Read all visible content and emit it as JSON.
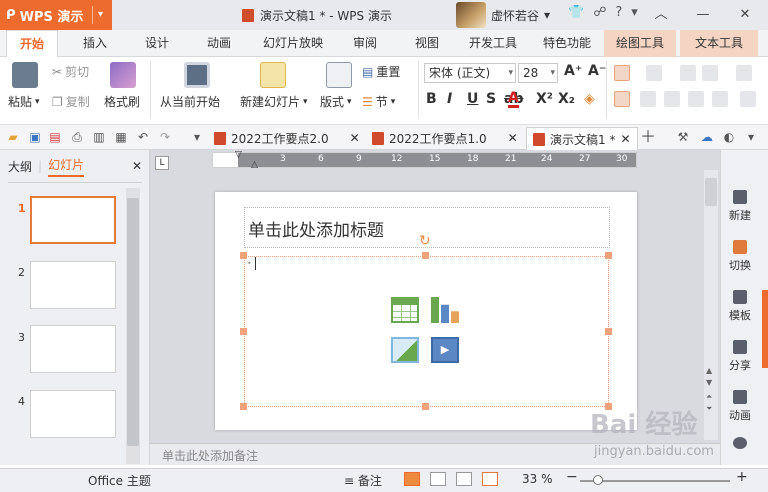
{
  "app": {
    "name": "WPS 演示",
    "doc_title": "演示文稿1 * - WPS 演示",
    "user": "虚怀若谷"
  },
  "tabs": [
    {
      "label": "开始",
      "active": true
    },
    {
      "label": "插入"
    },
    {
      "label": "设计"
    },
    {
      "label": "动画"
    },
    {
      "label": "幻灯片放映"
    },
    {
      "label": "审阅"
    },
    {
      "label": "视图"
    },
    {
      "label": "开发工具"
    },
    {
      "label": "特色功能"
    },
    {
      "label": "绘图工具",
      "context": true
    },
    {
      "label": "文本工具",
      "context": true
    }
  ],
  "ribbon": {
    "paste": "粘贴",
    "cut": "剪切",
    "copy": "复制",
    "format_painter": "格式刷",
    "play_current": "从当前开始",
    "new_slide": "新建幻灯片",
    "layout": "版式",
    "reset": "重置",
    "section": "节",
    "font": "宋体 (正文)",
    "font_size": "28"
  },
  "doc_tabs": [
    {
      "label": "2022工作要点2.0",
      "active": false
    },
    {
      "label": "2022工作要点1.0",
      "active": false
    },
    {
      "label": "演示文稿1 *",
      "active": true
    }
  ],
  "left_panel": {
    "tab_outline": "大纲",
    "tab_slides": "幻灯片",
    "slide_numbers": [
      "1",
      "2",
      "3",
      "4"
    ]
  },
  "ruler": {
    "ticks": [
      "3",
      "6",
      "9",
      "12",
      "15",
      "18",
      "21",
      "24",
      "27",
      "30"
    ]
  },
  "slide": {
    "title_placeholder": "单击此处添加标题"
  },
  "notes_placeholder": "单击此处添加备注",
  "right_panel": {
    "items": [
      "新建",
      "切换",
      "模板",
      "分享",
      "动画"
    ]
  },
  "status": {
    "theme": "Office 主题",
    "notes": "备注",
    "zoom": "33 %"
  },
  "watermark": {
    "brand": "Bai 经验",
    "url": "jingyan.baidu.com"
  },
  "colors": {
    "accent": "#ec6b2d",
    "context_tab": "#f4d5c4"
  }
}
